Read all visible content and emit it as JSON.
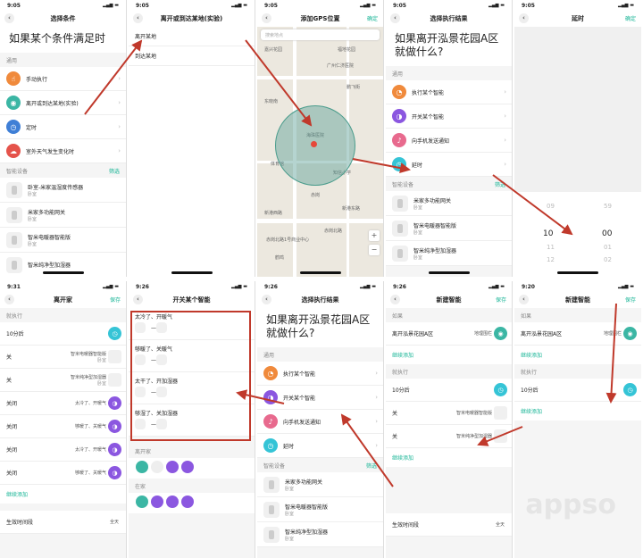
{
  "statusbar": {
    "t1": "9:05",
    "t2": "9:05",
    "t3": "9:05",
    "t4": "9:05",
    "t5": "9:05",
    "t6": "9:31",
    "t7": "9:26",
    "t8": "9:26",
    "t9": "9:26",
    "t10": "9:20"
  },
  "s1": {
    "title": "选择条件",
    "heading": "如果某个条件满足时",
    "section_general": "通用",
    "items": [
      "手动执行",
      "离开或到达某地(实验)",
      "定时",
      "室外天气发生变化时"
    ],
    "section_devices": "智能设备",
    "filter": "筛选",
    "devices": [
      {
        "name": "卧室-米家温湿度传感器",
        "sub": "卧室"
      },
      {
        "name": "米家多功能网关",
        "sub": "卧室"
      },
      {
        "name": "智米电暖器智能版",
        "sub": "卧室"
      },
      {
        "name": "智米纯净型加湿器",
        "sub": ""
      }
    ]
  },
  "s2": {
    "title": "离开或到达某地(实验)",
    "items": [
      "离开某地",
      "到达某地"
    ]
  },
  "s3": {
    "title": "添加GPS位置",
    "confirm": "确定",
    "search_placeholder": "搜索地点",
    "labels": [
      "嘉兴花园",
      "福地花园",
      "广州仁济医院",
      "鹏飞街",
      "赤岗街社区卫生服务中心街道分",
      "东晓南",
      "海珠医院",
      "赤岗街",
      "体育馆",
      "赤岗",
      "知信小学",
      "新港西路",
      "赤岗街东",
      "江海大道",
      "赤岗北路",
      "珠江港",
      "新港东路",
      "赤岗街社区",
      "珠江侨",
      "三建公司大院",
      "赤岗北路4号",
      "赤岗北1号",
      "鹤鸣",
      "赤岗北路1号商业中心",
      "赤岗"
    ],
    "zoom_in": "+",
    "zoom_out": "−"
  },
  "s4": {
    "title": "选择执行结果",
    "heading": "如果离开泓景花园A区就做什么?",
    "section_general": "通用",
    "items": [
      "执行某个智能",
      "开关某个智能",
      "向手机发送通知",
      "延时"
    ],
    "section_devices": "智能设备",
    "filter": "筛选",
    "devices": [
      {
        "name": "米家多功能网关",
        "sub": "卧室"
      },
      {
        "name": "智米电暖器智能版",
        "sub": "卧室"
      },
      {
        "name": "智米纯净型加湿器",
        "sub": "卧室"
      }
    ]
  },
  "s5": {
    "title": "延时",
    "confirm": "确定",
    "hours": [
      "08",
      "09",
      "10",
      "11",
      "12"
    ],
    "minutes": [
      "58",
      "59",
      "00",
      "01",
      "02"
    ]
  },
  "s6": {
    "title": "离开家",
    "save": "保存",
    "section_exec": "就执行",
    "rows": [
      {
        "label": "10分后",
        "right": "",
        "sub": ""
      },
      {
        "label": "关",
        "right": "智米电暖器智能版",
        "sub": "卧室"
      },
      {
        "label": "关",
        "right": "智米纯净型加湿器",
        "sub": "卧室"
      },
      {
        "label": "关闭",
        "right": "太冷了、开暖气",
        "sub": ""
      },
      {
        "label": "关闭",
        "right": "够暖了、关暖气",
        "sub": ""
      },
      {
        "label": "关闭",
        "right": "太冷了、开暖气",
        "sub": ""
      },
      {
        "label": "关闭",
        "right": "够暖了、关暖气",
        "sub": ""
      }
    ],
    "add": "继续添加",
    "effective": "生效时间段",
    "effective_val": "全天"
  },
  "s7": {
    "title": "开关某个智能",
    "items": [
      "太冷了、开暖气",
      "够暖了、关暖气",
      "太干了、开加湿器",
      "够湿了、关加湿器"
    ],
    "group1": "离开家",
    "group2": "在家"
  },
  "s8": {
    "title": "选择执行结果",
    "heading": "如果离开泓景花园A区就做什么?",
    "section_general": "通用",
    "items": [
      "执行某个智能",
      "开关某个智能",
      "向手机发送通知",
      "延时"
    ],
    "section_devices": "智能设备",
    "filter": "筛选",
    "devices": [
      {
        "name": "米家多功能网关",
        "sub": "卧室"
      },
      {
        "name": "智米电暖器智能版",
        "sub": "卧室"
      },
      {
        "name": "智米纯净型加湿器",
        "sub": "卧室"
      }
    ]
  },
  "s9": {
    "title": "新建智能",
    "save": "保存",
    "section_if": "如果",
    "cond": "离开泓景花园A区",
    "cond_right": "地理围栏",
    "add": "继续添加",
    "section_exec": "就执行",
    "rows": [
      {
        "label": "10分后",
        "right": ""
      },
      {
        "label": "关",
        "right": "智米电暖器智能版"
      },
      {
        "label": "关",
        "right": "智米纯净型加湿器"
      }
    ],
    "add2": "继续添加",
    "effective": "生效时间段",
    "effective_val": "全天"
  },
  "s10": {
    "title": "新建智能",
    "save": "保存",
    "section_if": "如果",
    "cond": "离开泓景花园A区",
    "cond_right": "地理围栏",
    "add": "继续添加",
    "section_exec": "就执行",
    "rows": [
      {
        "label": "10分后",
        "right": ""
      }
    ],
    "add2": "继续添加"
  },
  "watermark": "appso",
  "colors": {
    "accent": "#18b596",
    "orange": "#f08a3c",
    "teal": "#3bb6a4",
    "blue": "#3f7fd6",
    "red": "#e5534b",
    "purple": "#8b57e0",
    "pink": "#e86a8e",
    "cyan": "#35c4d6",
    "arrow": "#c0392b"
  }
}
